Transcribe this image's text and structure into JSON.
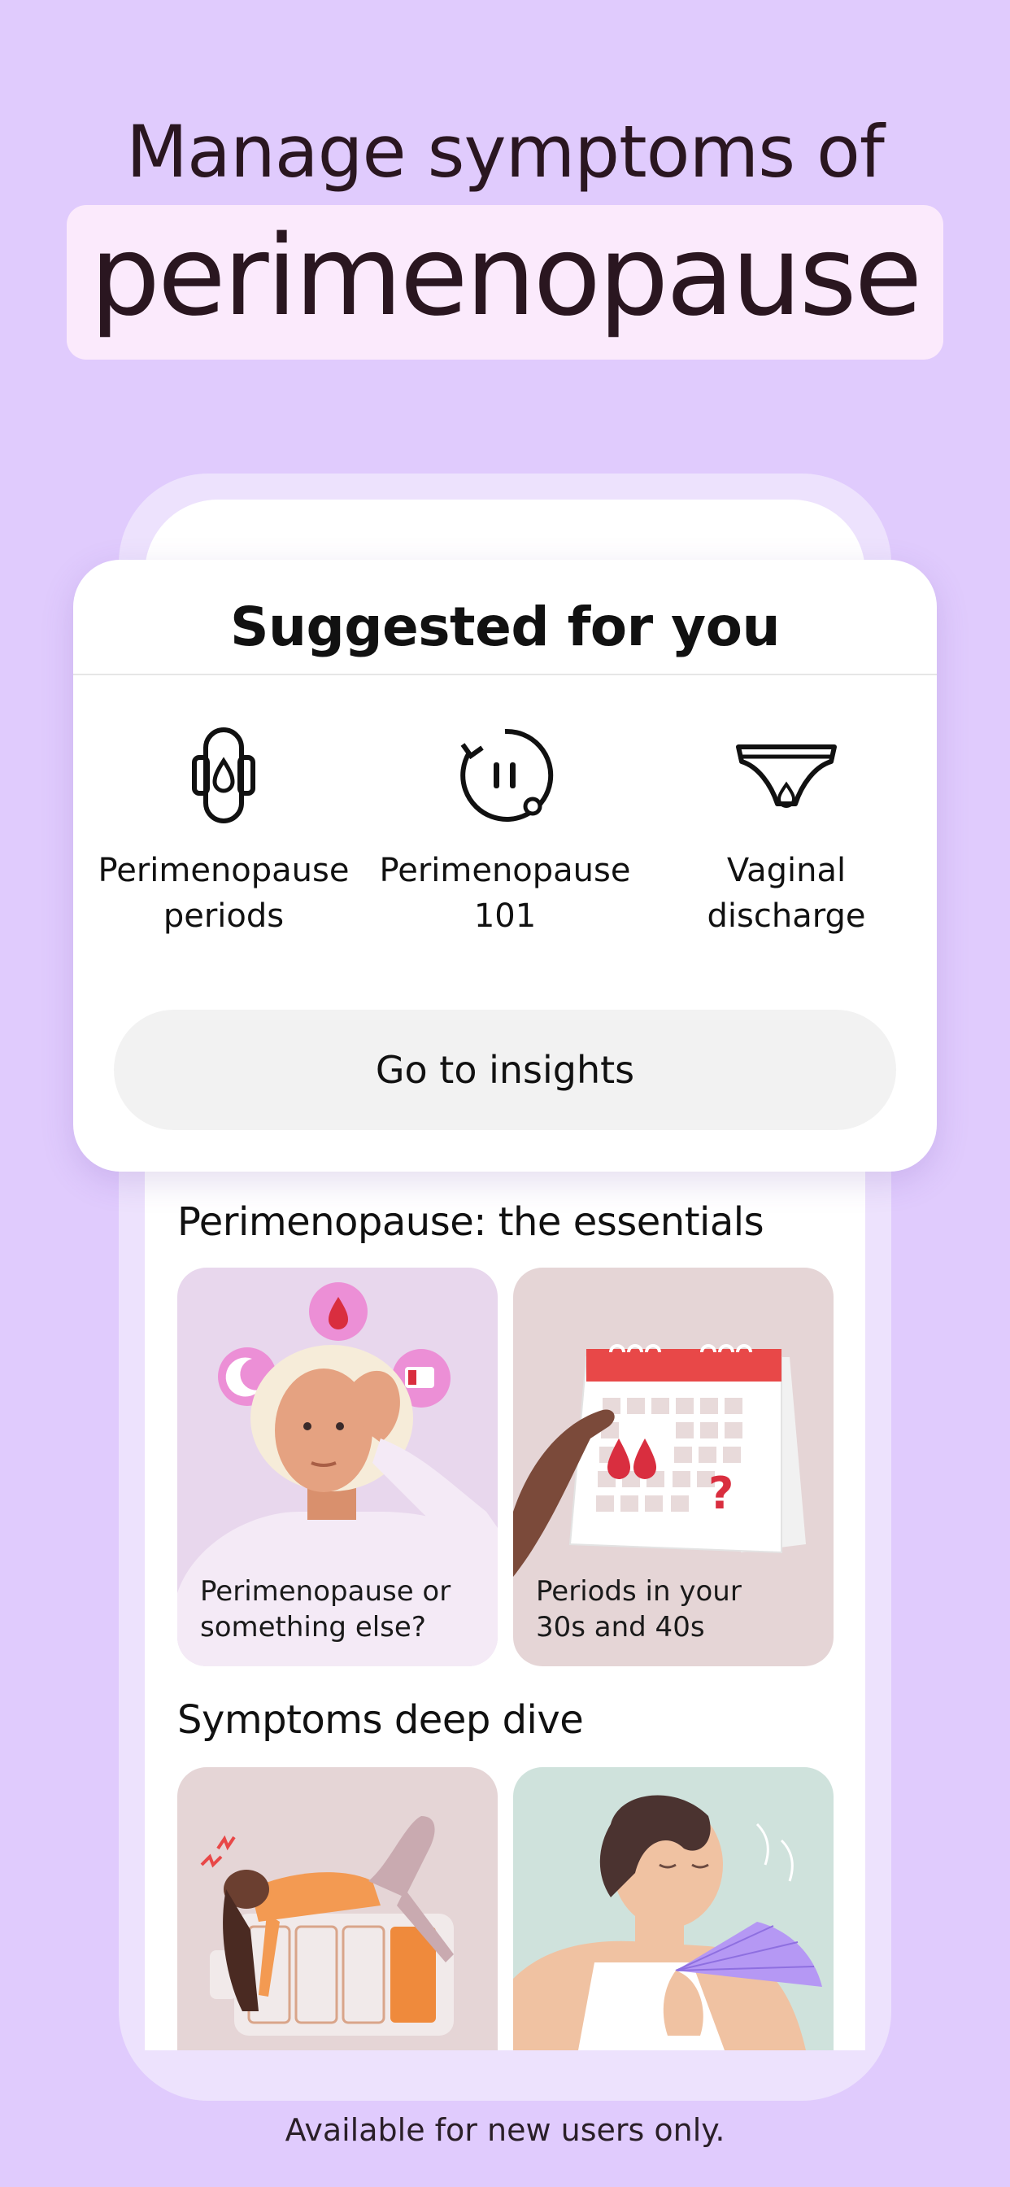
{
  "hero": {
    "line1": "Manage symptoms of",
    "highlight": "perimenopause"
  },
  "card": {
    "title": "Suggested for you",
    "items": [
      {
        "label_l1": "Perimenopause",
        "label_l2": "periods",
        "icon": "sanitary-pad-icon"
      },
      {
        "label_l1": "Perimenopause",
        "label_l2": "101",
        "icon": "cycle-pause-icon"
      },
      {
        "label_l1": "Vaginal",
        "label_l2": "discharge",
        "icon": "underwear-icon"
      }
    ],
    "button_label": "Go to insights"
  },
  "sections": {
    "essentials": {
      "title": "Perimenopause: the essentials",
      "tiles": [
        {
          "caption_l1": "Perimenopause or",
          "caption_l2": "something else?"
        },
        {
          "caption_l1": "Periods in your",
          "caption_l2": "30s and 40s"
        }
      ]
    },
    "deep_dive": {
      "title": "Symptoms deep dive"
    }
  },
  "footer": "Available for new users only.",
  "colors": {
    "background": "#e0cbfd",
    "highlight_box": "#fbeafc",
    "accent_pink": "#ec8fd6",
    "blood_red": "#d92e3f"
  }
}
